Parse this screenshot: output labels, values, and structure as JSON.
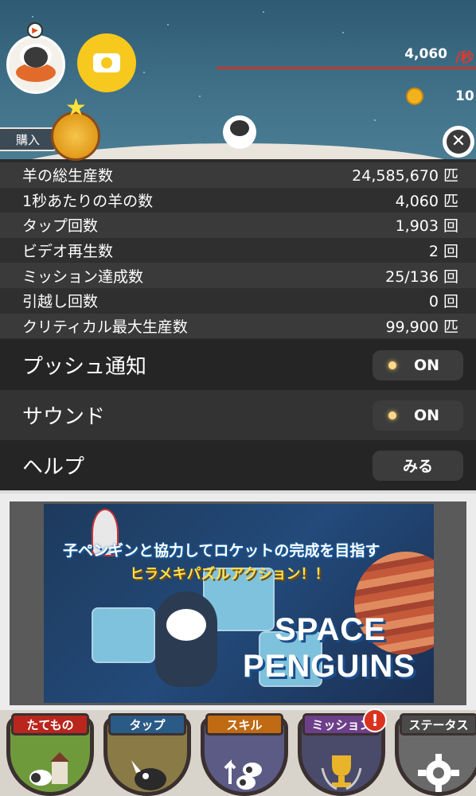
{
  "hud": {
    "rate_value": "4,060",
    "rate_unit": "/秒",
    "coins": "10",
    "buy_label": "購入"
  },
  "stats": [
    {
      "label": "羊の総生産数",
      "value": "24,585,670 匹"
    },
    {
      "label": "1秒あたりの羊の数",
      "value": "4,060 匹"
    },
    {
      "label": "タップ回数",
      "value": "1,903 回"
    },
    {
      "label": "ビデオ再生数",
      "value": "2 回"
    },
    {
      "label": "ミッション達成数",
      "value": "25/136 回"
    },
    {
      "label": "引越し回数",
      "value": "0 回"
    },
    {
      "label": "クリティカル最大生産数",
      "value": "99,900 匹"
    }
  ],
  "settings": {
    "push": {
      "label": "プッシュ通知",
      "value": "ON"
    },
    "sound": {
      "label": "サウンド",
      "value": "ON"
    },
    "help": {
      "label": "ヘルプ",
      "button": "みる"
    }
  },
  "ad": {
    "line1": "子ペンギンと協力してロケットの完成を目指す",
    "line2": "ヒラメキパズルアクション！！",
    "title1": "SPACE",
    "title2": "PENGUINS"
  },
  "nav": [
    {
      "label": "たてもの",
      "color": "#b8261e",
      "bg": "#6f9a3c",
      "icon": "building-icon"
    },
    {
      "label": "タップ",
      "color": "#2a5a86",
      "bg": "#8a7a46",
      "icon": "tap-icon"
    },
    {
      "label": "スキル",
      "color": "#c06a14",
      "bg": "#5b5b86",
      "icon": "skill-icon"
    },
    {
      "label": "ミッション",
      "color": "#6d3f8a",
      "bg": "#4a4a6a",
      "icon": "trophy-icon"
    },
    {
      "label": "ステータス",
      "color": "#4a4a4a",
      "bg": "#6a6a6a",
      "icon": "gear-icon"
    }
  ],
  "mission_badge": "!"
}
